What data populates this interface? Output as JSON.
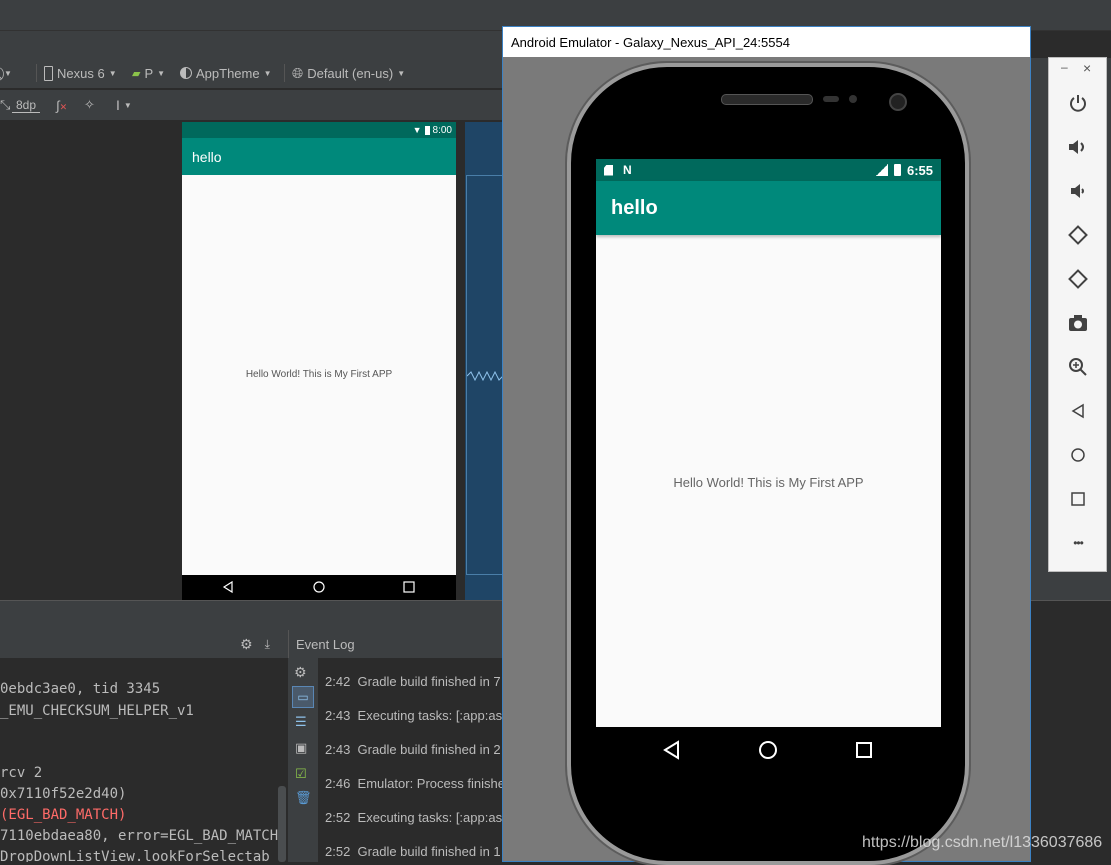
{
  "ide": {
    "toolbar1": {
      "device": "Nexus 6",
      "api": "P",
      "theme": "AppTheme",
      "locale": "Default (en-us)"
    },
    "toolbar2": {
      "margin": "8dp"
    },
    "design": {
      "status_time": "8:00",
      "app_title": "hello",
      "hello_text": "Hello World! This is My First APP"
    },
    "logcat": {
      "lines": [
        "0ebdc3ae0, tid 3345",
        "_EMU_CHECKSUM_HELPER_v1",
        "rcv 2",
        " 0x7110f52e2d40)",
        " (EGL_BAD_MATCH)",
        "7110ebdaea80, error=EGL_BAD_MATCH",
        "DropDownListView.lookForSelectab"
      ]
    },
    "event_log": {
      "title": "Event Log",
      "entries": [
        {
          "time": "2:42",
          "text": "Gradle build finished in 7"
        },
        {
          "time": "2:43",
          "text": "Executing tasks: [:app:ass"
        },
        {
          "time": "2:43",
          "text": "Gradle build finished in 2"
        },
        {
          "time": "2:46",
          "text": "Emulator: Process finishe"
        },
        {
          "time": "2:52",
          "text": "Executing tasks: [:app:ass"
        },
        {
          "time": "2:52",
          "text": "Gradle build finished in 1"
        }
      ]
    }
  },
  "emulator": {
    "window_title": "Android Emulator - Galaxy_Nexus_API_24:5554",
    "status_time": "6:55",
    "app_title": "hello",
    "hello_text": "Hello World! This is My First APP",
    "side_panel": {
      "minimize": "–",
      "close": "×",
      "more": "•••"
    }
  },
  "watermark": "https://blog.csdn.net/l1336037686",
  "colors": {
    "primary": "#00897b",
    "primary_dark": "#00695c",
    "ide_bg": "#2b2b2b",
    "error_text": "#ff6b68"
  }
}
